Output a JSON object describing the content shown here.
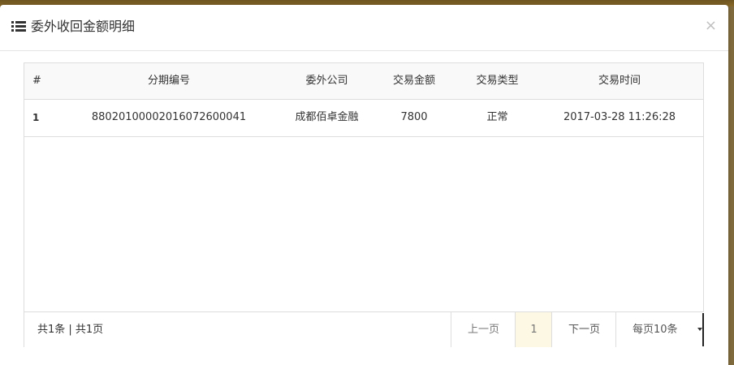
{
  "modal": {
    "title": "委外收回金额明细",
    "title_icon": "list-icon",
    "close_label": "×"
  },
  "table": {
    "headers": [
      "#",
      "分期编号",
      "委外公司",
      "交易金额",
      "交易类型",
      "交易时间"
    ],
    "rows": [
      [
        "1",
        "88020100002016072600041",
        "成都佰卓金融",
        "7800",
        "正常",
        "2017-03-28 11:26:28"
      ]
    ]
  },
  "pagination": {
    "summary": "共1条 | 共1页",
    "prev_label": "上一页",
    "current_page": "1",
    "next_label": "下一页",
    "page_size_label": "每页10条"
  },
  "colors": {
    "active_page_bg": "#fcf8e3",
    "header_bg": "#f9f9f9",
    "border": "#dddddd"
  }
}
